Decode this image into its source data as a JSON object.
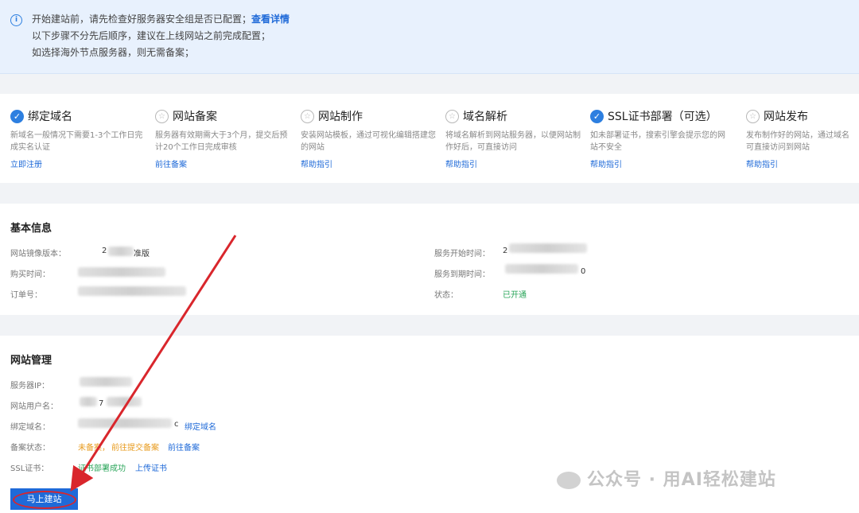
{
  "notice": {
    "line1": "开始建站前，请先检查好服务器安全组是否已配置；",
    "line1_link": "查看详情",
    "line2": "以下步骤不分先后顺序，建议在上线网站之前完成配置；",
    "line3": "如选择海外节点服务器，则无需备案；"
  },
  "steps": [
    {
      "title": "绑定域名",
      "desc": "新域名一般情况下需要1-3个工作日完成实名认证",
      "link": "立即注册",
      "icon": "check-icon"
    },
    {
      "title": "网站备案",
      "desc": "服务器有效期需大于3个月，提交后预计20个工作日完成审核",
      "link": "前往备案",
      "icon": "star-icon"
    },
    {
      "title": "网站制作",
      "desc": "安装网站模板，通过可视化编辑搭建您的网站",
      "link": "帮助指引",
      "icon": "star-icon"
    },
    {
      "title": "域名解析",
      "desc": "将域名解析到网站服务器，以便网站制作好后，可直接访问",
      "link": "帮助指引",
      "icon": "star-icon"
    },
    {
      "title": "SSL证书部署（可选）",
      "desc": "如未部署证书，搜索引擎会提示您的网站不安全",
      "link": "帮助指引",
      "icon": "check-icon"
    },
    {
      "title": "网站发布",
      "desc": "发布制作好的网站，通过域名可直接访问到网站",
      "link": "帮助指引",
      "icon": "star-icon"
    }
  ],
  "basic": {
    "title": "基本信息",
    "image_version_label": "网站镜像版本：",
    "image_version_value_prefix": "2",
    "image_version_value_suffix": "准版",
    "purchase_time_label": "购买时间：",
    "order_no_label": "订单号：",
    "service_start_label": "服务开始时间：",
    "service_start_value_prefix": "2",
    "service_end_label": "服务到期时间：",
    "service_end_value_suffix": "0",
    "status_label": "状态：",
    "status_value": "已开通"
  },
  "mgmt": {
    "title": "网站管理",
    "server_ip_label": "服务器IP：",
    "site_user_label": "网站用户名：",
    "site_user_value": "7",
    "domain_label": "绑定域名：",
    "domain_value_suffix": "c",
    "domain_link": "绑定域名",
    "filing_label": "备案状态：",
    "filing_value": "未备案，",
    "filing_link1": "前往提交备案",
    "filing_link2": "前往备案",
    "ssl_label": "SSL证书：",
    "ssl_value": "证书部署成功",
    "ssl_link": "上传证书",
    "build_button": "马上建站"
  },
  "watermark": "公众号 · 用AI轻松建站",
  "colors": {
    "accent": "#1f6ad8",
    "success": "#2aa55a",
    "warning": "#e89b1e",
    "annotation_red": "#d9262c"
  }
}
